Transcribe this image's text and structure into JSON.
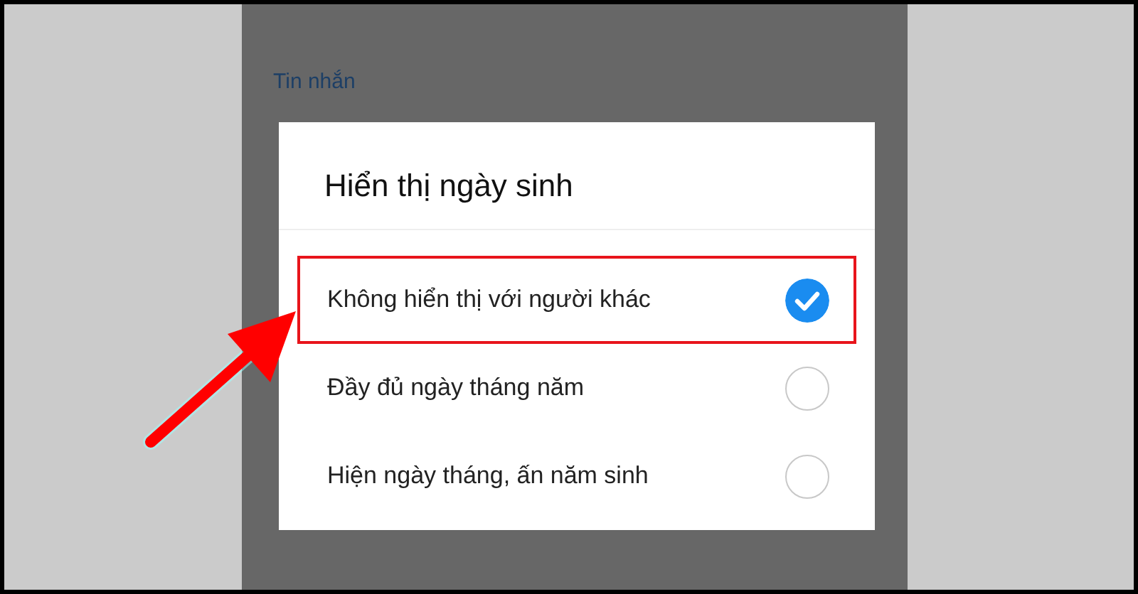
{
  "screen": {
    "section_title": "Tin nhắn"
  },
  "dialog": {
    "title": "Hiển thị ngày sinh",
    "options": [
      {
        "label": "Không hiển thị với người khác",
        "selected": true,
        "highlighted": true
      },
      {
        "label": "Đầy đủ ngày tháng năm",
        "selected": false,
        "highlighted": false
      },
      {
        "label": "Hiện ngày tháng, ấn năm sinh",
        "selected": false,
        "highlighted": false
      }
    ]
  },
  "annotation": {
    "kind": "arrow"
  }
}
